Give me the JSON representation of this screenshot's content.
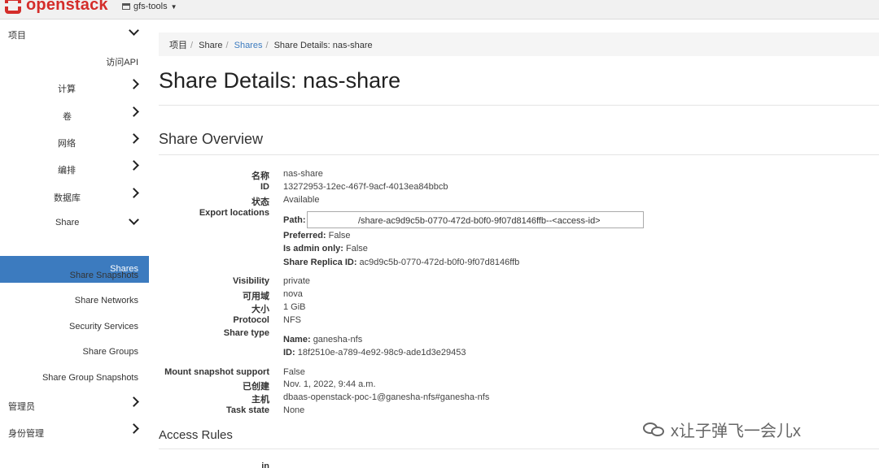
{
  "topbar": {
    "brand": "openstack",
    "project": "gfs-tools"
  },
  "sidebar": {
    "project_label": "项目",
    "access_api": "访问API",
    "items": [
      {
        "label": "计算"
      },
      {
        "label": "卷"
      },
      {
        "label": "网络"
      },
      {
        "label": "编排"
      },
      {
        "label": "数据库"
      },
      {
        "label": "Share"
      }
    ],
    "share_items": [
      {
        "label": "Shares"
      },
      {
        "label": "Share Snapshots"
      },
      {
        "label": "Share Networks"
      },
      {
        "label": "Security Services"
      },
      {
        "label": "Share Groups"
      },
      {
        "label": "Share Group Snapshots"
      }
    ],
    "admin_label": "管理员",
    "identity_label": "身份管理"
  },
  "breadcrumb": {
    "item1": "项目",
    "item2": "Share",
    "item3": "Shares",
    "item4": "Share Details: nas-share"
  },
  "page_title": "Share Details: nas-share",
  "overview_title": "Share Overview",
  "details": {
    "name_label": "名称",
    "name": "nas-share",
    "id_label": "ID",
    "id": "13272953-12ec-467f-9acf-4013ea84bbcb",
    "status_label": "状态",
    "status": "Available",
    "export_label": "Export locations",
    "path_label": "Path:",
    "path_value": "/share-ac9d9c5b-0770-472d-b0f0-9f07d8146ffb--<access-id>",
    "preferred_label": "Preferred:",
    "preferred": "False",
    "admin_only_label": "Is admin only:",
    "admin_only": "False",
    "replica_label": "Share Replica ID:",
    "replica": "ac9d9c5b-0770-472d-b0f0-9f07d8146ffb",
    "visibility_label": "Visibility",
    "visibility": "private",
    "az_label": "可用域",
    "az": "nova",
    "size_label": "大小",
    "size": "1 GiB",
    "protocol_label": "Protocol",
    "protocol": "NFS",
    "share_type_label": "Share type",
    "st_name_label": "Name:",
    "st_name": "ganesha-nfs",
    "st_id_label": "ID:",
    "st_id": "18f2510e-a789-4e92-98c9-ade1d3e29453",
    "mount_label": "Mount snapshot support",
    "mount": "False",
    "created_label": "已创建",
    "created": "Nov. 1, 2022, 9:44 a.m.",
    "host_label": "主机",
    "host": "dbaas-openstack-poc-1@ganesha-nfs#ganesha-nfs",
    "task_label": "Task state",
    "task": "None"
  },
  "access_rules_title": "Access Rules",
  "access_rules_cut": "in",
  "watermark": "x让子弹飞一会儿x"
}
